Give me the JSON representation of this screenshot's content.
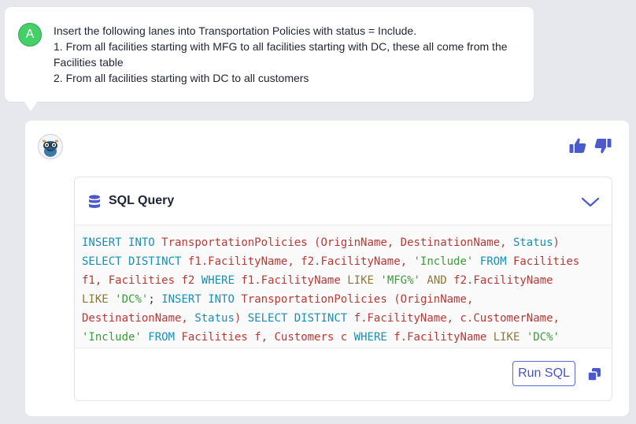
{
  "user_message": {
    "avatar_letter": "A",
    "lines": [
      "Insert the following lanes into Transportation Policies with status = Include.",
      "1. From all facilities starting with MFG to all facilities starting with DC, these all come from the",
      "Facilities table",
      "2. From all facilities starting with DC to all customers"
    ]
  },
  "reply": {
    "feedback": {
      "thumbs_up_icon": "thumbs-up-icon",
      "thumbs_down_icon": "thumbs-down-icon"
    },
    "sql_panel": {
      "title": "SQL Query",
      "icon": "database-icon",
      "collapse_icon": "chevron-down-icon",
      "code_lines": [
        "INSERT INTO TransportationPolicies (OriginName, DestinationName, Status)",
        "SELECT DISTINCT f1.FacilityName, f2.FacilityName, 'Include' FROM Facilities",
        "f1, Facilities f2 WHERE f1.FacilityName LIKE 'MFG%' AND f2.FacilityName",
        "LIKE 'DC%'; INSERT INTO TransportationPolicies (OriginName,",
        "DestinationName, Status) SELECT DISTINCT f.FacilityName, c.CustomerName,",
        "'Include' FROM Facilities f, Customers c WHERE f.FacilityName LIKE 'DC%'"
      ],
      "run_label": "Run SQL",
      "copy_icon": "copy-icon"
    }
  },
  "colors": {
    "accent": "#5b6bd6",
    "keyword": "#1a8fb4",
    "identifier": "#b73a37",
    "string": "#3e9b3c",
    "user_avatar": "#45cf69"
  }
}
